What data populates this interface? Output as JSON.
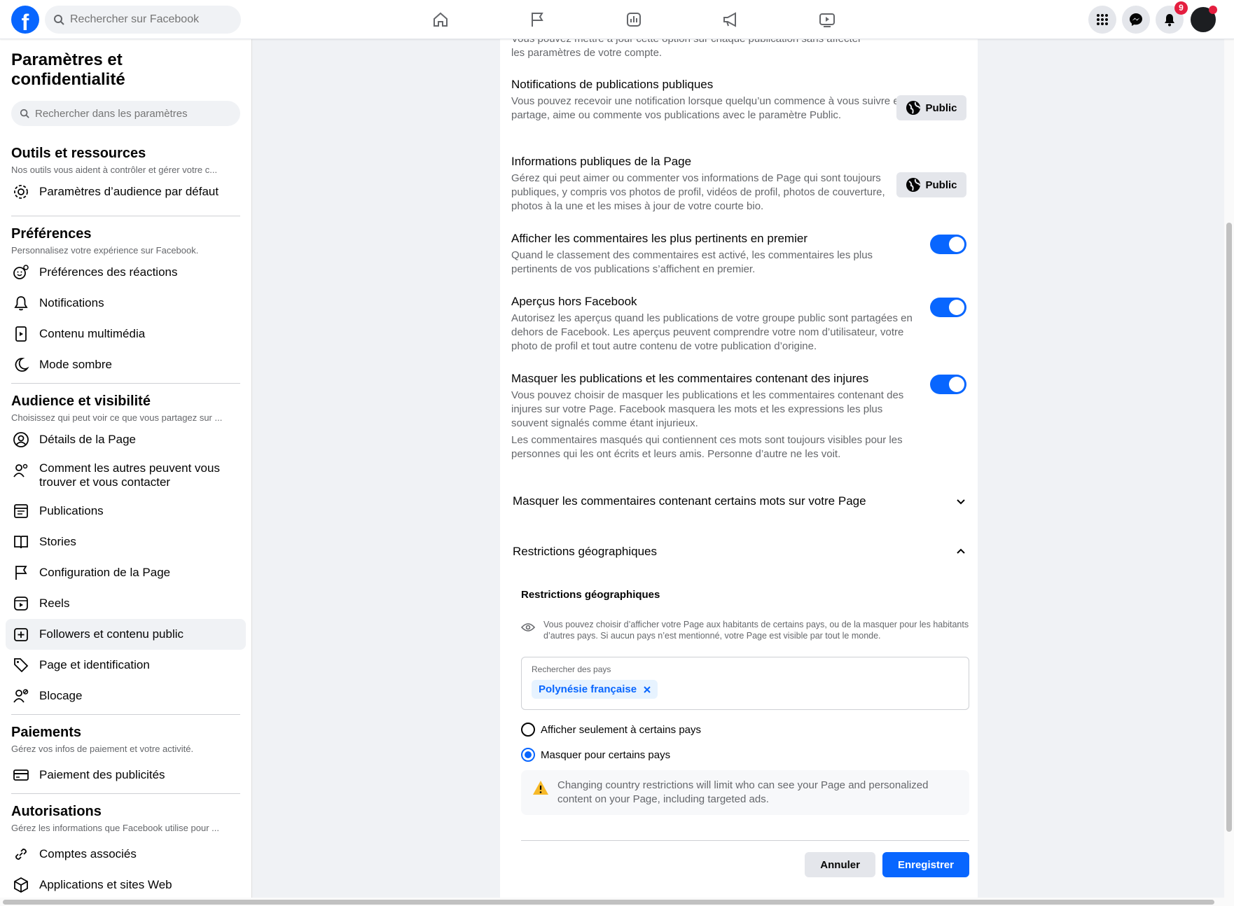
{
  "topbar": {
    "logo_letter": "f",
    "search_placeholder": "Rechercher sur Facebook",
    "nav": [
      "home-icon",
      "flag-icon",
      "insights-icon",
      "megaphone-icon",
      "video-icon"
    ],
    "notification_count": "9"
  },
  "sidebar": {
    "title": "Paramètres et confidentialité",
    "search_placeholder": "Rechercher dans les paramètres",
    "tools": {
      "heading": "Outils et ressources",
      "sub": "Nos outils vous aident à contrôler et gérer votre c...",
      "items": [
        "Paramètres d’audience par défaut"
      ]
    },
    "preferences": {
      "heading": "Préférences",
      "sub": "Personnalisez votre expérience sur Facebook.",
      "items": [
        "Préférences des réactions",
        "Notifications",
        "Contenu multimédia",
        "Mode sombre"
      ]
    },
    "audience": {
      "heading": "Audience et visibilité",
      "sub": "Choisissez qui peut voir ce que vous partagez sur ...",
      "items": [
        "Détails de la Page",
        "Comment les autres peuvent vous trouver et vous contacter",
        "Publications",
        "Stories",
        "Configuration de la Page",
        "Reels",
        "Followers et contenu public",
        "Page et identification",
        "Blocage"
      ]
    },
    "payments": {
      "heading": "Paiements",
      "sub": "Gérez vos infos de paiement et votre activité.",
      "items": [
        "Paiement des publicités"
      ]
    },
    "permissions": {
      "heading": "Autorisations",
      "sub": "Gérez les informations que Facebook utilise pour ...",
      "items": [
        "Comptes associés",
        "Applications et sites Web"
      ]
    }
  },
  "main": {
    "top_cut_text_1": "Vous pouvez mettre à jour cette option sur chaque publication sans affecter",
    "top_cut_text_2": "les paramètres de votre compte.",
    "settings": [
      {
        "title": "Notifications de publications publiques",
        "desc": "Vous pouvez recevoir une notification lorsque quelqu’un commence à vous suivre et partage, aime ou commente vos publications avec le paramètre Public.",
        "control": "Public"
      },
      {
        "title": "Informations publiques de la Page",
        "desc": "Gérez qui peut aimer ou commenter vos informations de Page qui sont toujours publiques, y compris vos photos de profil, vidéos de profil, photos de couverture, photos à la une et les mises à jour de votre courte bio.",
        "control": "Public"
      },
      {
        "title": "Afficher les commentaires les plus pertinents en premier",
        "desc": "Quand le classement des commentaires est activé, les commentaires les plus pertinents de vos publications s’affichent en premier.",
        "toggle": true
      },
      {
        "title": "Aperçus hors Facebook",
        "desc": "Autorisez les aperçus quand les publications de votre groupe public sont partagées en dehors de Facebook. Les aperçus peuvent comprendre votre nom d’utilisateur, votre photo de profil et tout autre contenu de votre publication d’origine.",
        "toggle": true
      },
      {
        "title": "Masquer les publications et les commentaires contenant des injures",
        "desc": "Vous pouvez choisir de masquer les publications et les commentaires contenant des injures sur votre Page. Facebook masquera les mots et les expressions les plus souvent signalés comme étant injurieux.",
        "desc2": "Les commentaires masqués qui contiennent ces mots sont toujours visibles pour les personnes qui les ont écrits et leurs amis. Personne d’autre ne les voit.",
        "toggle": true
      }
    ],
    "accordion_words": "Masquer les commentaires contenant certains mots sur votre Page",
    "accordion_geo": "Restrictions géographiques",
    "geo": {
      "title": "Restrictions géographiques",
      "info": "Vous pouvez choisir d’afficher votre Page aux habitants de certains pays, ou de la masquer pour les habitants d’autres pays. Si aucun pays n’est mentionné, votre Page est visible par tout le monde.",
      "field_label": "Rechercher des pays",
      "chip": "Polynésie française",
      "radio_show": "Afficher seulement à certains pays",
      "radio_hide": "Masquer pour certains pays",
      "warning": "Changing country restrictions will limit who can see your Page and personalized content on your Page, including targeted ads.",
      "cancel": "Annuler",
      "save": "Enregistrer"
    }
  },
  "colors": {
    "accent": "#0866ff",
    "badge": "#e41e3f"
  }
}
